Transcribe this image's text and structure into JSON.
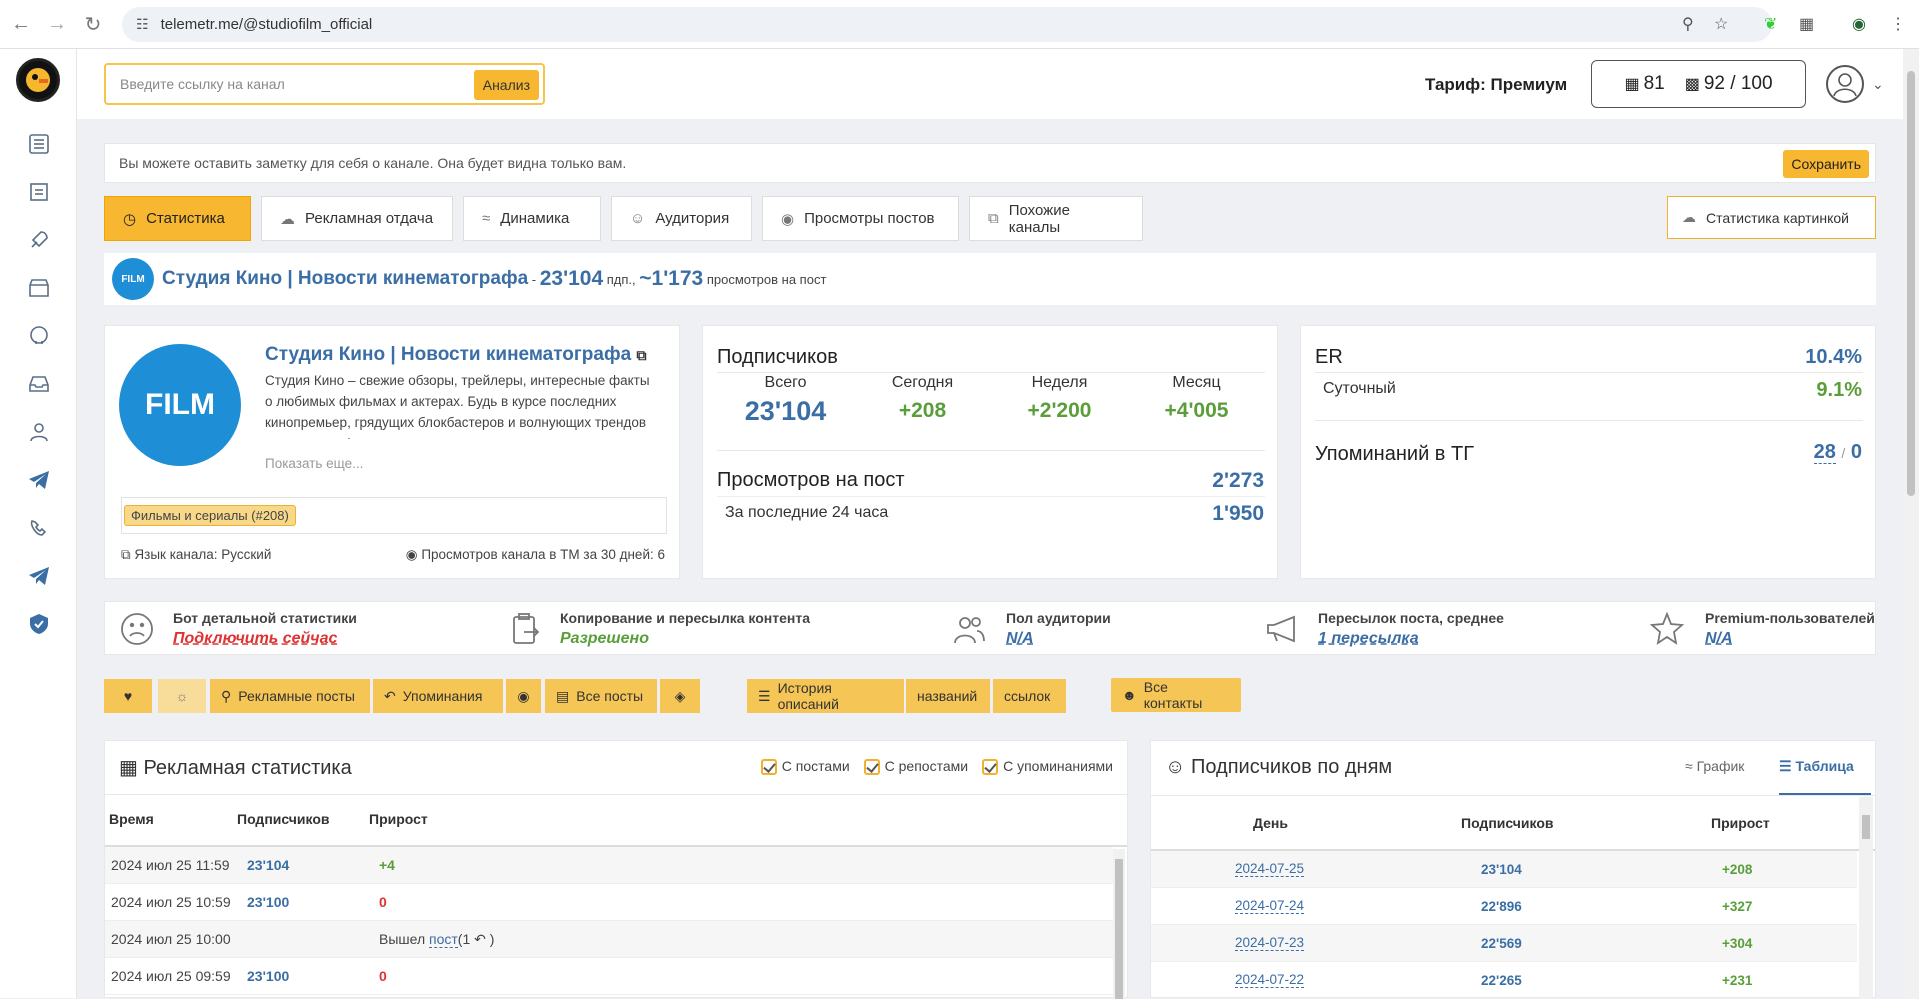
{
  "browser": {
    "url": "telemetr.me/@studiofilm_official"
  },
  "search": {
    "placeholder": "Введите ссылку на канал",
    "button": "Анализ"
  },
  "header": {
    "tariff": "Тариф: Премиум",
    "counter_days": "81",
    "counter_reports": "92 / 100"
  },
  "note": {
    "text": "Вы можете оставить заметку для себя о канале. Она будет видна только вам.",
    "save": "Сохранить"
  },
  "tabs": [
    "Статистика",
    "Рекламная отдача",
    "Динамика",
    "Аудитория",
    "Просмотры постов",
    "Похожие каналы"
  ],
  "tab_image_stats": "Статистика картинкой",
  "channel_bar": {
    "title": "Студия Кино | Новости кинематографа",
    "dash": " - ",
    "subs": "23'104",
    "subs_unit": " пдп., ",
    "views": "~1'173",
    "views_unit": " просмотров на пост"
  },
  "channel": {
    "name": "Студия Кино | Новости кинематографа",
    "desc": "Студия Кино – свежие обзоры, трейлеры, интересные факты о любимых фильмах и актерах. Будь в курсе последних кинопремьер, грядущих блокбастеров и волнующих трендов кинематографа",
    "more": "Показать еще...",
    "category": "Фильмы и сериалы (#208)",
    "lang": "Язык канала: Русский",
    "tm_views": "Просмотров канала в ТМ за 30 дней: 6",
    "logo_text": "FILM"
  },
  "subscribers": {
    "title": "Подписчиков",
    "cols": [
      {
        "label": "Всего",
        "value": "23'104"
      },
      {
        "label": "Сегодня",
        "value": "+208"
      },
      {
        "label": "Неделя",
        "value": "+2'200"
      },
      {
        "label": "Месяц",
        "value": "+4'005"
      }
    ],
    "views_label": "Просмотров на пост",
    "views_value": "2'273",
    "last24_label": "За последние 24 часа",
    "last24_value": "1'950"
  },
  "er": {
    "label": "ER",
    "value": "10.4%",
    "daily_label": "Суточный",
    "daily_value": "9.1%",
    "mentions_label": "Упоминаний в ТГ",
    "mentions_a": "28",
    "mentions_sep": "/",
    "mentions_b": "0"
  },
  "info": [
    {
      "h": "Бот детальной статистики",
      "v": "Подключить сейчас"
    },
    {
      "h": "Копирование и пересылка контента",
      "v": "Разрешено"
    },
    {
      "h": "Пол аудитории",
      "v": "N/A"
    },
    {
      "h": "Пересылок поста, среднее",
      "v": "1 пересылка"
    },
    {
      "h": "Premium-пользователей",
      "v": "N/A"
    }
  ],
  "actions": {
    "ads": "Рекламные посты",
    "mentions": "Упоминания",
    "all": "Все посты",
    "history": "История описаний",
    "names": "названий",
    "links": "ссылок",
    "contacts": "Все контакты"
  },
  "ad_stats": {
    "title": "Рекламная статистика",
    "filters": [
      "С постами",
      "С репостами",
      "С упоминаниями"
    ],
    "headers": [
      "Время",
      "Подписчиков",
      "Прирост"
    ],
    "rows": [
      {
        "time": "2024 июл 25 11:59",
        "subs": "23'104",
        "delta": "+4",
        "kind": "plus"
      },
      {
        "time": "2024 июл 25 10:59",
        "subs": "23'100",
        "delta": "0",
        "kind": "zero"
      },
      {
        "time": "2024 июл 25 10:00",
        "subs": "",
        "delta": "",
        "kind": "post",
        "post_prefix": "Вышел ",
        "post_link": "пост",
        "post_count": "(1",
        "post_suffix": " )"
      },
      {
        "time": "2024 июл 25 09:59",
        "subs": "23'100",
        "delta": "0",
        "kind": "zero"
      }
    ]
  },
  "daily": {
    "title": "Подписчиков по дням",
    "tab_chart": "График",
    "tab_table": "Таблица",
    "headers": [
      "День",
      "Подписчиков",
      "Прирост"
    ],
    "rows": [
      {
        "day": "2024-07-25",
        "subs": "23'104",
        "delta": "+208"
      },
      {
        "day": "2024-07-24",
        "subs": "22'896",
        "delta": "+327"
      },
      {
        "day": "2024-07-23",
        "subs": "22'569",
        "delta": "+304"
      },
      {
        "day": "2024-07-22",
        "subs": "22'265",
        "delta": "+231"
      }
    ]
  }
}
